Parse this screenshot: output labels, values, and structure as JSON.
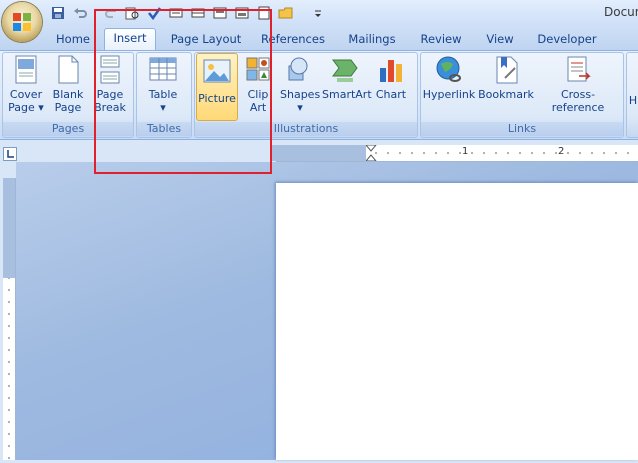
{
  "window": {
    "title": "Docum"
  },
  "tabs": [
    {
      "label": "Home"
    },
    {
      "label": "Insert"
    },
    {
      "label": "Page Layout"
    },
    {
      "label": "References"
    },
    {
      "label": "Mailings"
    },
    {
      "label": "Review"
    },
    {
      "label": "View"
    },
    {
      "label": "Developer"
    }
  ],
  "groups": {
    "pages": {
      "label": "Pages",
      "buttons": [
        {
          "l1": "Cover",
          "l2": "Page ▾"
        },
        {
          "l1": "Blank",
          "l2": "Page"
        },
        {
          "l1": "Page",
          "l2": "Break"
        }
      ]
    },
    "tables": {
      "label": "Tables",
      "buttons": [
        {
          "l1": "Table",
          "l2": "▾"
        }
      ]
    },
    "illustrations": {
      "label": "Illustrations",
      "buttons": [
        {
          "l1": "Picture"
        },
        {
          "l1": "Clip",
          "l2": "Art"
        },
        {
          "l1": "Shapes",
          "l2": "▾"
        },
        {
          "l1": "SmartArt"
        },
        {
          "l1": "Chart"
        }
      ]
    },
    "links": {
      "label": "Links",
      "buttons": [
        {
          "l1": "Hyperlink"
        },
        {
          "l1": "Bookmark"
        },
        {
          "l1": "Cross-reference"
        }
      ]
    },
    "next": {
      "l1": "H"
    }
  },
  "ruler": {
    "marks": [
      "1",
      "2"
    ]
  },
  "colors": {
    "highlight": "#e0202a",
    "ribbon_text": "#15428b",
    "active_button": "#ffd977"
  }
}
